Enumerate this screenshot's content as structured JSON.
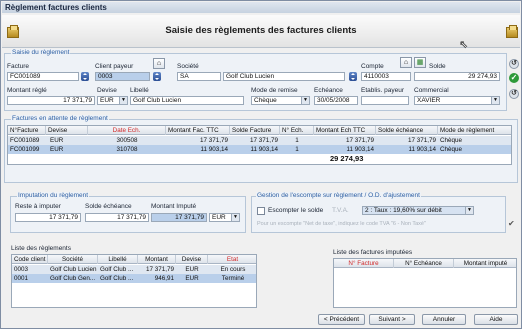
{
  "window": {
    "title": "Règlement factures clients"
  },
  "banner": {
    "title": "Saisie des règlements des factures clients"
  },
  "saisie": {
    "group_title": "Saisie du règlement",
    "facture_label": "Facture",
    "facture_value": "FC001089",
    "client_payeur_label": "Client payeur",
    "client_payeur_value": "0003",
    "societe_label": "Société",
    "societe_code": "SA",
    "societe_name": "Golf Club Lucien",
    "compte_label": "Compte",
    "compte_value": "4110003",
    "solde_label": "Solde",
    "solde_value": "29 274,93",
    "montant_regle_label": "Montant réglé",
    "montant_regle_value": "17 371,79",
    "devise_label": "Devise",
    "devise_value": "EUR",
    "libelle_label": "Libellé",
    "libelle_value": "Golf Club Lucien",
    "mode_remise_label": "Mode de remise",
    "mode_remise_value": "Chèque",
    "echeance_label": "Echéance",
    "echeance_value": "30/05/2008",
    "etablis_label": "Etablis. payeur",
    "etablis_value": "",
    "commercial_label": "Commercial",
    "commercial_value": "XAVIER"
  },
  "factures": {
    "group_title": "Factures en attente de règlement",
    "headers": [
      "N°Facture",
      "Devise",
      "Date Ech.",
      "Montant Fac. TTC",
      "Solde Facture",
      "N° Ech.",
      "Montant Ech TTC",
      "Solde échéance",
      "Mode de règlement"
    ],
    "rows": [
      [
        "FC001089",
        "EUR",
        "300508",
        "17 371,79",
        "17 371,79",
        "1",
        "17 371,79",
        "17 371,79",
        "Chèque"
      ],
      [
        "FC001099",
        "EUR",
        "310708",
        "11 903,14",
        "11 903,14",
        "1",
        "11 903,14",
        "11 903,14",
        "Chèque"
      ]
    ],
    "total": "29 274,93"
  },
  "imputation": {
    "group_title": "Imputation du règlement",
    "reste_label": "Reste à imputer",
    "reste_value": "17 371,79",
    "solde_ech_label": "Solde échéance",
    "solde_ech_value": "17 371,79",
    "montant_impute_label": "Montant Imputé",
    "montant_impute_value": "17 371,79",
    "devise_value": "EUR"
  },
  "escompte": {
    "group_title": "Gestion de l'escompte sur règlement / O.D. d'ajustement",
    "checkbox_label": "Escompter le solde",
    "taux_label": "T.V.A.",
    "taux_value": "2 : Taux : 19,60% sur débit",
    "hint": "Pour un escompte \"Net de taxe\", indiquez le code TVA \"6 - Non Taxé\""
  },
  "reglements": {
    "title": "Liste des règlements",
    "headers": [
      "Code client",
      "Société",
      "Libellé",
      "Montant",
      "Devise",
      "Etat"
    ],
    "rows": [
      [
        "0003",
        "Golf Club Lucien",
        "Golf Club ...",
        "17 371,79",
        "EUR",
        "En cours"
      ],
      [
        "0001",
        "Golf Club Gen...",
        "Golf Club ...",
        "946,91",
        "EUR",
        "Terminé"
      ]
    ]
  },
  "imputees": {
    "title": "Liste des factures imputées",
    "headers": [
      "N° Facture",
      "N° Echéance",
      "Montant imputé"
    ]
  },
  "buttons": {
    "prev": "< Précédent",
    "next": "Suivant >",
    "cancel": "Annuler",
    "help": "Aide"
  }
}
